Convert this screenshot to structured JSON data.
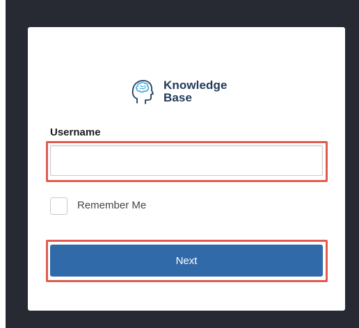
{
  "brand": {
    "logo_line1": "Knowledge",
    "logo_line2": "Base",
    "logo_icon": "head-brain-icon",
    "text_color": "#1f3a5a",
    "icon_color": "#3aa9e0"
  },
  "form": {
    "username_label": "Username",
    "username_value": "",
    "remember_label": "Remember Me",
    "remember_checked": false,
    "next_label": "Next"
  },
  "colors": {
    "backdrop": "#272a33",
    "card": "#ffffff",
    "primary_button": "#316aa9",
    "highlight": "#e05a4e"
  }
}
